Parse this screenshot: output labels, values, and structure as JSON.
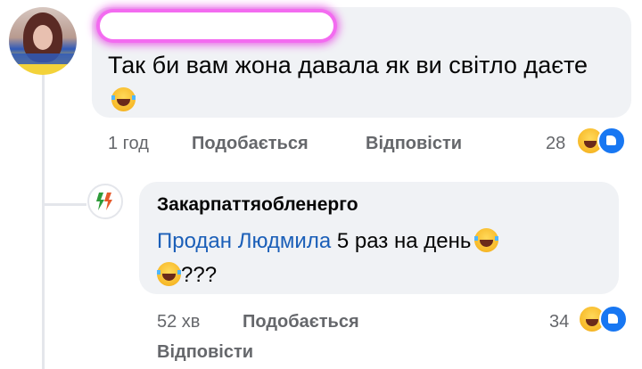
{
  "comment1": {
    "text": "Так би вам жона давала як ви світло даєте",
    "time": "1 год",
    "like_label": "Подобається",
    "reply_label": "Відповісти",
    "reaction_count": "28",
    "emoji": "laughing-emoji"
  },
  "comment2": {
    "author": "Закарпаттяобленерго",
    "mention": "Продан Людмила",
    "text": " 5 раз на день",
    "suffix": "???",
    "time": "52 хв",
    "like_label": "Подобається",
    "reply_label": "Відповісти",
    "reaction_count": "34"
  },
  "colors": {
    "bubble": "#f0f2f5",
    "mention": "#1b5fb8",
    "meta": "#65676b",
    "like_blue": "#1877f2",
    "haha_yellow": "#f7b928",
    "highlight": "#f36bf0"
  }
}
